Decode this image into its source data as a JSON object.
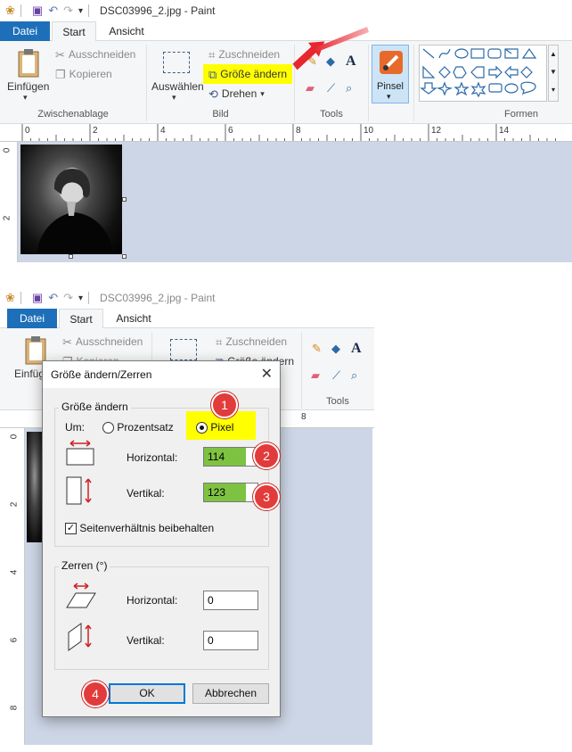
{
  "top": {
    "title": "DSC03996_2.jpg - Paint",
    "tabs": {
      "file": "Datei",
      "home": "Start",
      "view": "Ansicht"
    },
    "clipboard": {
      "paste": "Einfügen",
      "cut": "Ausschneiden",
      "copy": "Kopieren",
      "group": "Zwischenablage"
    },
    "image": {
      "select": "Auswählen",
      "crop": "Zuschneiden",
      "resize": "Größe ändern",
      "rotate": "Drehen",
      "group": "Bild"
    },
    "tools": {
      "group": "Tools"
    },
    "brushes": {
      "label": "Pinsel"
    },
    "shapes": {
      "group": "Formen"
    },
    "ruler": [
      "0",
      "2",
      "4",
      "6",
      "8",
      "10",
      "12",
      "14"
    ],
    "ruler_v": [
      "0",
      "2"
    ]
  },
  "bottom": {
    "title": "DSC03996_2.jpg - Paint",
    "tabs": {
      "file": "Datei",
      "home": "Start",
      "view": "Ansicht"
    },
    "clipboard": {
      "paste": "Einfüge",
      "cut": "Ausschneiden",
      "copy": "Kopieren"
    },
    "image": {
      "crop": "Zuschneiden",
      "resize": "Größe ändern"
    },
    "tools": {
      "group": "Tools"
    },
    "ruler": [
      "8"
    ],
    "ruler_v": [
      "0",
      "2",
      "4",
      "6",
      "8"
    ]
  },
  "dialog": {
    "title": "Größe ändern/Zerren",
    "resize_group": "Größe ändern",
    "by_label": "Um:",
    "percent_label": "Prozentsatz",
    "pixel_label": "Pixel",
    "horizontal_label": "Horizontal:",
    "vertical_label": "Vertikal:",
    "horizontal_value": "114",
    "vertical_value": "123",
    "aspect_label": "Seitenverhältnis beibehalten",
    "skew_group": "Zerren (°)",
    "skew_horizontal_label": "Horizontal:",
    "skew_vertical_label": "Vertikal:",
    "skew_horizontal_value": "0",
    "skew_vertical_value": "0",
    "ok_label": "OK",
    "cancel_label": "Abbrechen",
    "close_glyph": "✕"
  },
  "steps": [
    "1",
    "2",
    "3",
    "4"
  ],
  "colors": {
    "accent": "#1e6fb9",
    "highlight": "#ffff00",
    "badge": "#e23b3b",
    "arrow": "#e8262f",
    "field_green": "#7ec242",
    "canvas": "#cdd6e6"
  },
  "icons": [
    "paint-app-icon",
    "save-icon",
    "undo-icon",
    "redo-icon",
    "customize-arrow-icon",
    "clipboard-icon",
    "scissors-icon",
    "copy-icon",
    "select-icon",
    "crop-icon",
    "resize-icon",
    "rotate-icon",
    "pencil-icon",
    "fill-icon",
    "text-icon",
    "eraser-icon",
    "picker-icon",
    "magnifier-icon",
    "brush-icon",
    "shapes-icon",
    "close-icon"
  ]
}
